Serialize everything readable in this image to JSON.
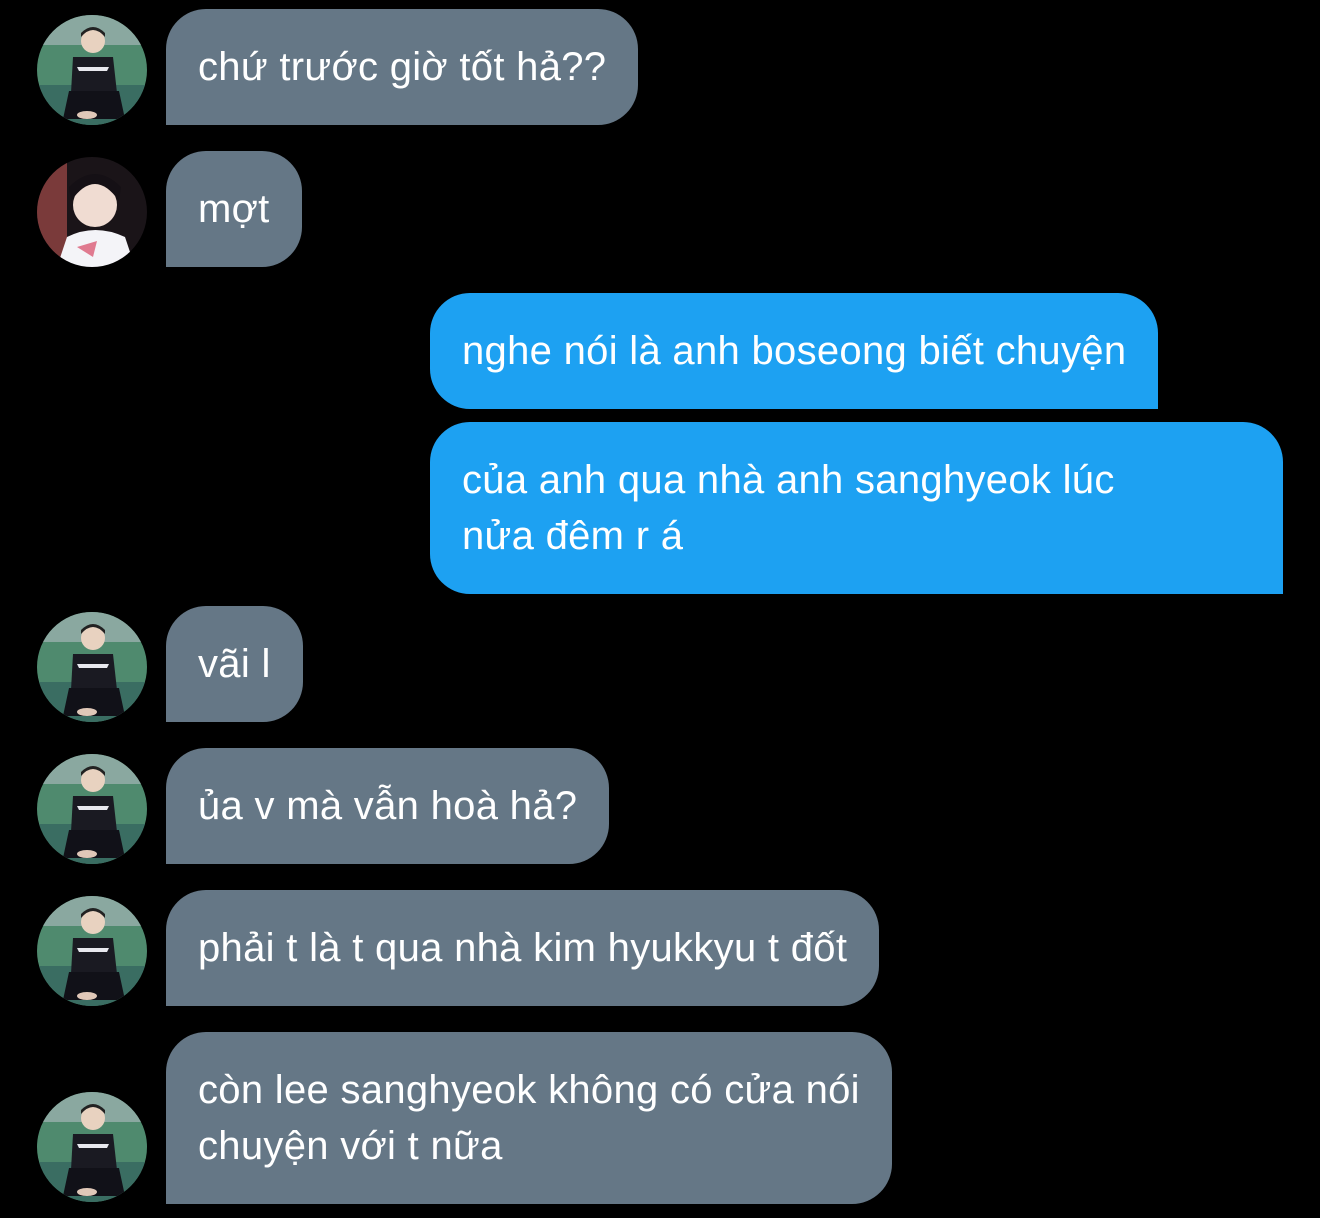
{
  "colors": {
    "background": "#000000",
    "incoming_bubble": "#657786",
    "outgoing_bubble": "#1da1f2",
    "text": "#ffffff"
  },
  "messages": [
    {
      "direction": "incoming",
      "avatar": "avatar-a",
      "lines": [
        "chứ trước giờ tốt hả??"
      ]
    },
    {
      "direction": "incoming",
      "avatar": "avatar-b",
      "lines": [
        "mợt"
      ]
    },
    {
      "direction": "outgoing",
      "lines": [
        "nghe nói là anh boseong biết chuyện"
      ]
    },
    {
      "direction": "outgoing",
      "lines": [
        "của anh qua nhà anh sanghyeok lúc",
        "nửa đêm r á"
      ]
    },
    {
      "direction": "incoming",
      "avatar": "avatar-a",
      "lines": [
        "vãi l"
      ]
    },
    {
      "direction": "incoming",
      "avatar": "avatar-a",
      "lines": [
        "ủa v mà vẫn hoà hả?"
      ]
    },
    {
      "direction": "incoming",
      "avatar": "avatar-a",
      "lines": [
        "phải t là t qua nhà kim hyukkyu t đốt"
      ]
    },
    {
      "direction": "incoming",
      "avatar": "avatar-a",
      "lines": [
        "còn lee sanghyeok không có cửa nói",
        "chuyện với t nữa"
      ]
    }
  ]
}
